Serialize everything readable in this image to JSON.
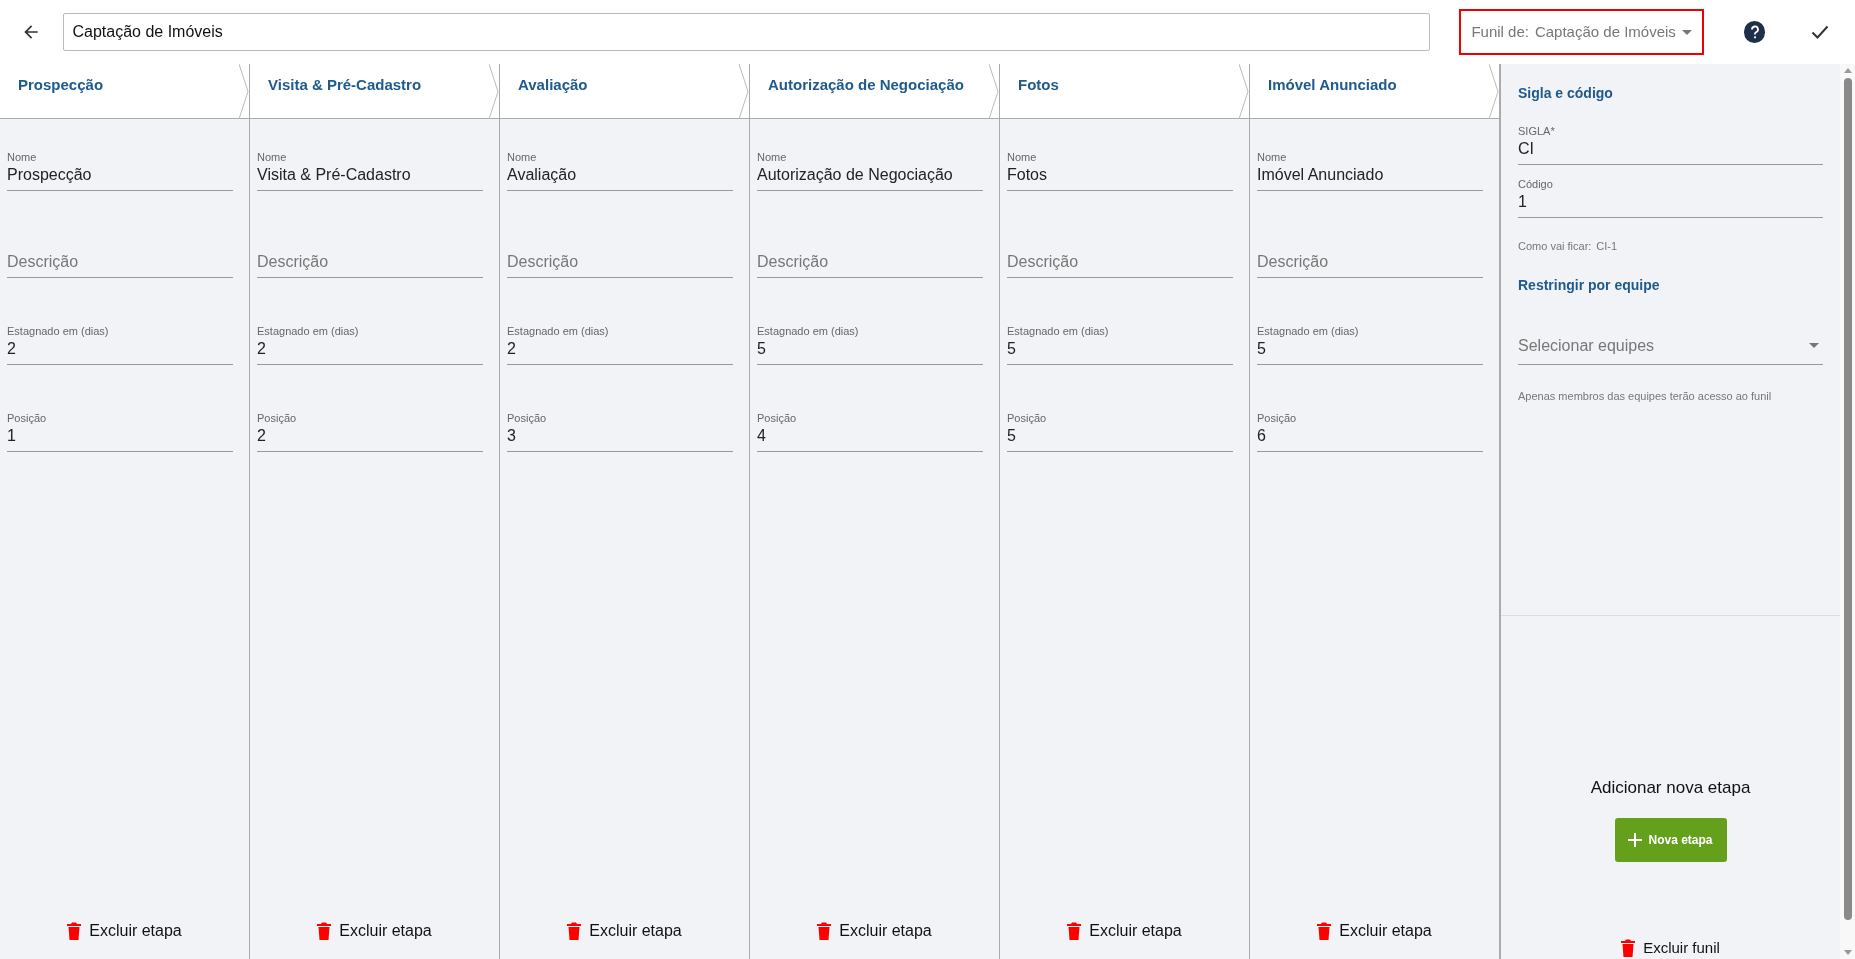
{
  "toolbar": {
    "title_value": "Captação de Imóveis",
    "funnel_select": {
      "label": "Funil de:",
      "value": "Captação de Imóveis",
      "highlighted": true
    }
  },
  "stages": [
    {
      "title": "Prospecção",
      "fields": [
        {
          "label": "Nome",
          "value": "Prospecção"
        },
        {
          "placeholder": "Descrição"
        },
        {
          "label": "Estagnado em (dias)",
          "value": "2"
        },
        {
          "label": "Posição",
          "value": "1"
        }
      ],
      "delete": "Excluir etapa"
    },
    {
      "title": "Visita & Pré-Cadastro",
      "fields": [
        {
          "label": "Nome",
          "value": "Visita & Pré-Cadastro"
        },
        {
          "placeholder": "Descrição"
        },
        {
          "label": "Estagnado em (dias)",
          "value": "2"
        },
        {
          "label": "Posição",
          "value": "2"
        }
      ],
      "delete": "Excluir etapa"
    },
    {
      "title": "Avaliação",
      "fields": [
        {
          "label": "Nome",
          "value": "Avaliação"
        },
        {
          "placeholder": "Descrição"
        },
        {
          "label": "Estagnado em (dias)",
          "value": "2"
        },
        {
          "label": "Posição",
          "value": "3"
        }
      ],
      "delete": "Excluir etapa"
    },
    {
      "title": "Autorização de Negociação",
      "fields": [
        {
          "label": "Nome",
          "value": "Autorização de Negociação"
        },
        {
          "placeholder": "Descrição"
        },
        {
          "label": "Estagnado em (dias)",
          "value": "5"
        },
        {
          "label": "Posição",
          "value": "4"
        }
      ],
      "delete": "Excluir etapa"
    },
    {
      "title": "Fotos",
      "fields": [
        {
          "label": "Nome",
          "value": "Fotos"
        },
        {
          "placeholder": "Descrição"
        },
        {
          "label": "Estagnado em (dias)",
          "value": "5"
        },
        {
          "label": "Posição",
          "value": "5"
        }
      ],
      "delete": "Excluir etapa"
    },
    {
      "title": "Imóvel Anunciado",
      "fields": [
        {
          "label": "Nome",
          "value": "Imóvel Anunciado"
        },
        {
          "placeholder": "Descrição"
        },
        {
          "label": "Estagnado em (dias)",
          "value": "5"
        },
        {
          "label": "Posição",
          "value": "6"
        }
      ],
      "delete": "Excluir etapa"
    }
  ],
  "side_panel": {
    "section_title": "Sigla e código",
    "sigla": {
      "label": "SIGLA*",
      "value": "CI"
    },
    "codigo": {
      "label": "Código",
      "value": "1"
    },
    "preview_label": "Como vai ficar:",
    "preview_value": "CI-1",
    "team_title": "Restringir por equipe",
    "team_select": {
      "placeholder": "Selecionar equipes"
    },
    "team_hint": "Apenas membros das equipes terão acesso ao funil",
    "add_title": "Adicionar nova etapa",
    "add_button": "Nova etapa",
    "delete_funnel": "Excluir funil"
  }
}
